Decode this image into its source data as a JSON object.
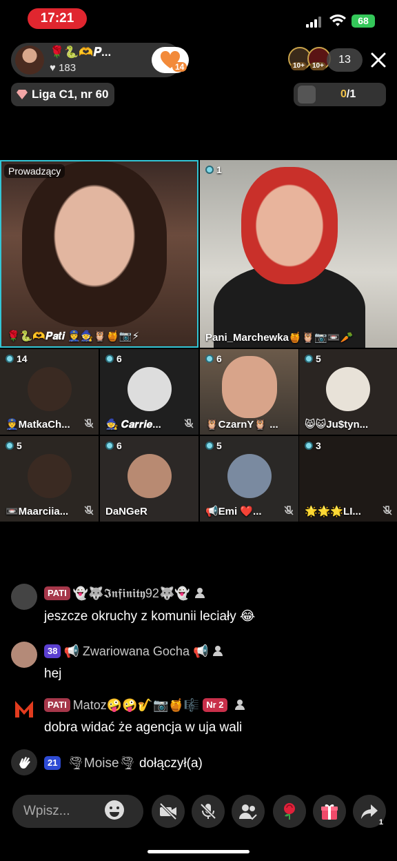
{
  "status": {
    "time": "17:21",
    "battery": "68"
  },
  "host": {
    "name": "🌹🐍🫶𝑷...",
    "likes": "♥ 183",
    "follow_count": "14"
  },
  "viewers": {
    "badge_1": "10+",
    "badge_2": "10+",
    "count": "13"
  },
  "league": {
    "label": "Liga C1, nr 60"
  },
  "goal": {
    "current": "0",
    "total": "/1"
  },
  "host_tile": {
    "tag": "Prowadzący",
    "name": "🌹🐍🫶𝑷𝒂𝒕𝒊 👮🧙🦉🍯📷⚡"
  },
  "guest_tile": {
    "count": "1",
    "name": "Pani_Marchewka🍯🦉📷📼🥕"
  },
  "tiles": [
    {
      "count": "14",
      "name": "👮MatkaCh..."
    },
    {
      "count": "6",
      "name": "🧙 𝑪𝒂𝒓𝒓𝒊𝒆..."
    },
    {
      "count": "6",
      "name": "🦉CzarnY🦉 ..."
    },
    {
      "count": "5",
      "name": "😸😺Ju$tyn..."
    },
    {
      "count": "5",
      "name": "📼Maarciia..."
    },
    {
      "count": "6",
      "name": "DaNGeR"
    },
    {
      "count": "5",
      "name": "📢Emi ❤️..."
    },
    {
      "count": "3",
      "name": "🌟🌟🌟LI..."
    }
  ],
  "chat": [
    {
      "badge": "PATI",
      "user": "👻🐺𝕴𝖓𝖋𝖎𝖓𝖎𝖙𝖞92🐺👻",
      "message": "jeszcze okruchy z komunii leciały 😂"
    },
    {
      "badge": "38",
      "user": "📢 Zwariowana Gocha 📢",
      "message": "hej"
    },
    {
      "badge": "PATI",
      "user": "Matoz🤪🤪🎷📷🍯🎼",
      "badge2": "Nr 2",
      "message": "dobra widać że agencja w uja wali"
    }
  ],
  "joined": {
    "badge": "21",
    "user": "🌪Moise🌪",
    "action": "dołączył(a)"
  },
  "input": {
    "placeholder": "Wpisz..."
  },
  "share_count": "1"
}
